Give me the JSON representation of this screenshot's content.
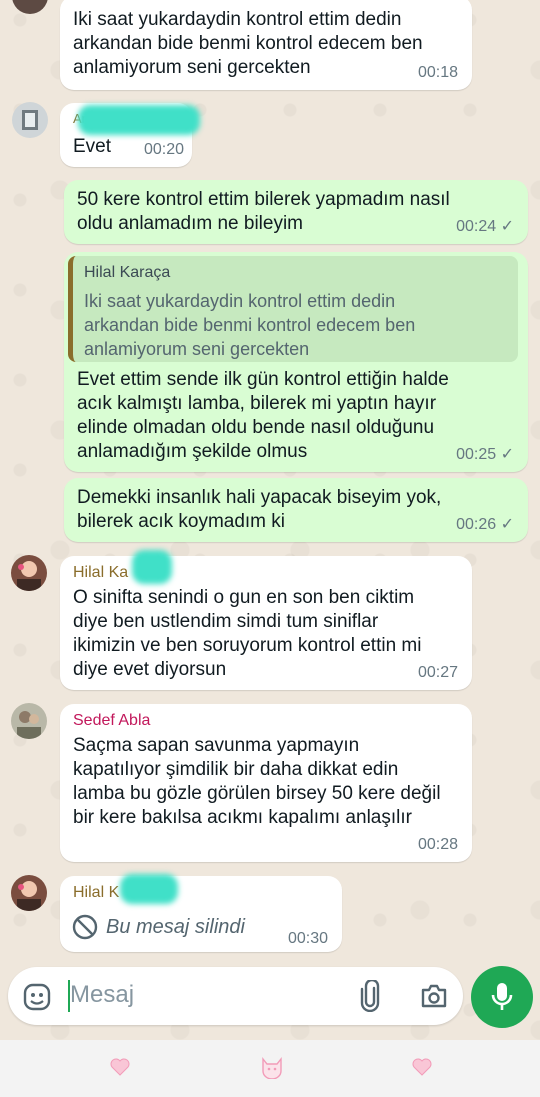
{
  "messages": [
    {
      "text": "Iki saat yukardaydin kontrol ettim dedin\narkandan bide benmi kontrol edecem ben\nanlamiyorum seni gercekten",
      "time": "00:18"
    },
    {
      "sender": "An",
      "text": "Evet",
      "time": "00:20"
    },
    {
      "text": "50 kere kontrol ettim bilerek yapmadım nasıl\noldu anlamadım ne bileyim",
      "time": "00:24 ✓"
    },
    {
      "quote_sender": "Hilal Karaça",
      "quote_text": "Iki saat yukardaydin kontrol ettim dedin\narkandan bide benmi kontrol edecem ben\nanlamiyorum seni gercekten",
      "text": "Evet ettim sende ilk gün kontrol ettiğin halde\nacık kalmıştı lamba, bilerek mi yaptın hayır\nelinde olmadan oldu bende nasıl olduğunu\nanlamadığım şekilde olmus",
      "time": "00:25 ✓"
    },
    {
      "text": "Demekki insanlık hali yapacak biseyim yok,\nbilerek acık koymadım ki",
      "time": "00:26 ✓"
    },
    {
      "sender": "Hilal Ka",
      "text": "O sinifta senindi o gun en son ben ciktim\ndiye ben ustlendim simdi tum siniflar\nikimizin ve ben soruyorum kontrol ettin mi\ndiye evet diyorsun",
      "time": "00:27"
    },
    {
      "sender": "Sedef Abla",
      "text": "Saçma sapan savunma yapmayın\nkapatılıyor şimdilik bir daha dikkat edin\nlamba bu gözle görülen birsey 50 kere değil\nbir kere bakılsa acıkmı kapalımı anlaşılır",
      "time": "00:28"
    },
    {
      "sender": "Hilal K",
      "text": "Bu mesaj silindi",
      "time": "00:30"
    }
  ],
  "composer": {
    "placeholder": "Mesaj"
  },
  "colors": {
    "outgoing": "#d9fdd3",
    "incoming": "#ffffff",
    "accent": "#1fa855",
    "sender_hilal": "#8a6d2b",
    "sender_sedef": "#c2185b"
  },
  "icons": [
    "sticker-icon",
    "attach-icon",
    "camera-icon",
    "mic-icon",
    "heart-icon",
    "cat-face-icon"
  ]
}
